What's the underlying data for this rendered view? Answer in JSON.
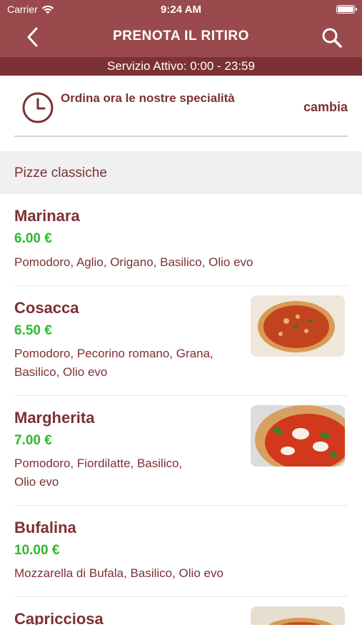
{
  "status_bar": {
    "carrier": "Carrier",
    "time": "9:24 AM"
  },
  "nav": {
    "title": "PRENOTA IL RITIRO",
    "back_icon": "chevron-left-icon",
    "search_icon": "search-icon"
  },
  "service": {
    "text": "Servizio Attivo: 0:00 - 23:59"
  },
  "order": {
    "text": "Ordina ora le nostre specialità",
    "change_label": "cambia",
    "icon": "clock-icon"
  },
  "category": {
    "label": "Pizze classiche"
  },
  "items": [
    {
      "name": "Marinara",
      "price": "6.00 €",
      "desc_line1": "Pomodoro, Aglio, Origano, Basilico, Olio evo",
      "desc_line2": ""
    },
    {
      "name": "Cosacca",
      "price": "6.50 €",
      "desc_line1": "Pomodoro, Pecorino romano, Grana,",
      "desc_line2": "Basilico, Olio evo"
    },
    {
      "name": "Margherita",
      "price": "7.00 €",
      "desc_line1": "Pomodoro, Fiordilatte, Basilico,",
      "desc_line2": "Olio evo"
    },
    {
      "name": "Bufalina",
      "price": "10.00 €",
      "desc_line1": "Mozzarella di Bufala, Basilico, Olio evo",
      "desc_line2": ""
    },
    {
      "name": "Capricciosa",
      "price": "",
      "desc_line1": "",
      "desc_line2": ""
    }
  ],
  "colors": {
    "header": "#9a4a4c",
    "service_bar": "#7c3134",
    "brand_text": "#7c3134",
    "price": "#2eb82e"
  }
}
